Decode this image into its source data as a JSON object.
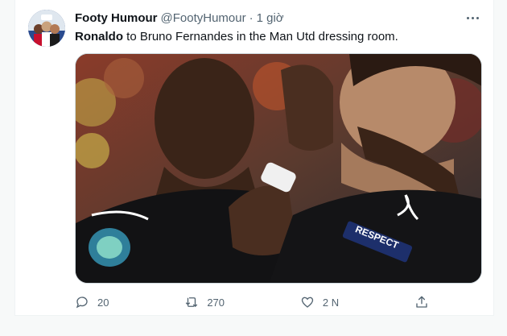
{
  "tweet": {
    "display_name": "Footy Humour",
    "handle": "@FootyHumour",
    "separator": "·",
    "time": "1 giờ",
    "text_bold": "Ronaldo",
    "text_rest": " to Bruno Fernandes in the Man Utd dressing room.",
    "media": {
      "jersey_badge_text": "RESPECT"
    }
  },
  "actions": {
    "reply_count": "20",
    "retweet_count": "270",
    "like_count": "2 N"
  },
  "colors": {
    "text_primary": "#0f1419",
    "text_secondary": "#536471",
    "border": "#cfd9de"
  }
}
